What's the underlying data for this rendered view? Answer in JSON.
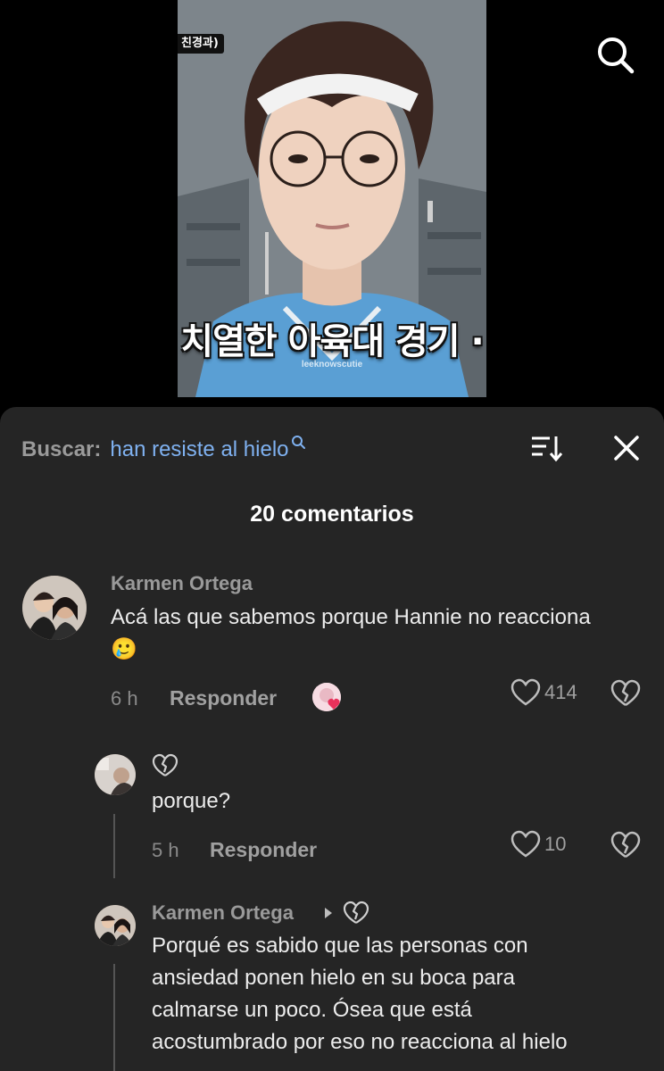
{
  "video": {
    "tag": "친경과)",
    "caption": "치열한 아육대 경기 ·",
    "watermark": "leeknowscutie"
  },
  "search": {
    "label": "Buscar:",
    "query": "han resiste al hielo"
  },
  "comments_header": {
    "count_text": "20 comentarios"
  },
  "comments": [
    {
      "author": "Karmen Ortega",
      "text_line1": "Acá las que sabemos porque Hannie no reacciona",
      "text_line2": "🥲",
      "time": "6 h",
      "reply_label": "Responder",
      "likes": "414"
    }
  ],
  "replies": [
    {
      "text": "porque?",
      "time": "5 h",
      "reply_label": "Responder",
      "likes": "10"
    },
    {
      "author": "Karmen Ortega",
      "lines": [
        "Porqué es sabido que las personas con",
        "ansiedad ponen hielo en su boca para",
        "calmarse un poco. Ósea que está",
        "acostumbrado por eso no reacciona al hielo"
      ]
    }
  ],
  "colors": {
    "sheet_bg": "#252525",
    "query_blue": "#7fb1f0",
    "muted_text": "#9a9a9a"
  }
}
